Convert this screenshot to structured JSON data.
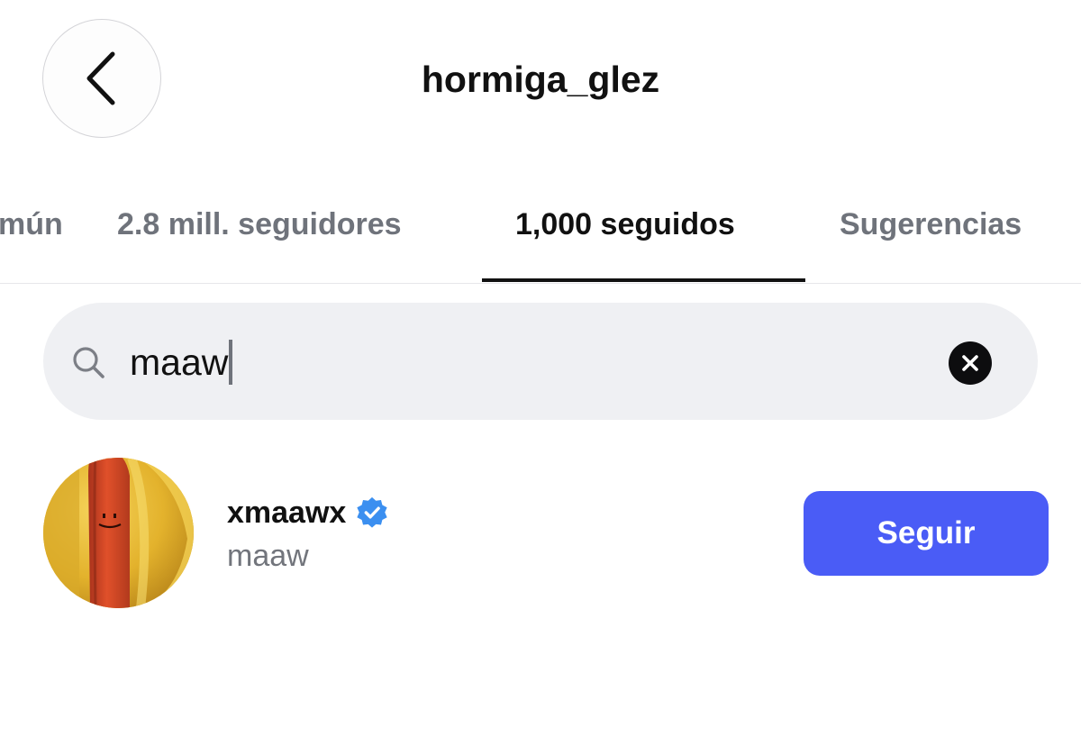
{
  "header": {
    "title": "hormiga_glez",
    "back_icon": "chevron-left-icon"
  },
  "tabs": [
    {
      "label": "mún",
      "active": false
    },
    {
      "label": "2.8 mill. seguidores",
      "active": false
    },
    {
      "label": "1,000 seguidos",
      "active": true
    },
    {
      "label": "Sugerencias",
      "active": false
    }
  ],
  "search": {
    "value": "maaw",
    "icon": "search-icon",
    "clear_icon": "clear-icon"
  },
  "results": [
    {
      "username": "xmaawx",
      "verified": true,
      "display_name": "maaw",
      "follow_label": "Seguir"
    }
  ],
  "colors": {
    "accent": "#4a5cf6",
    "verified": "#3b8ff0",
    "search_bg": "#eff0f3"
  }
}
